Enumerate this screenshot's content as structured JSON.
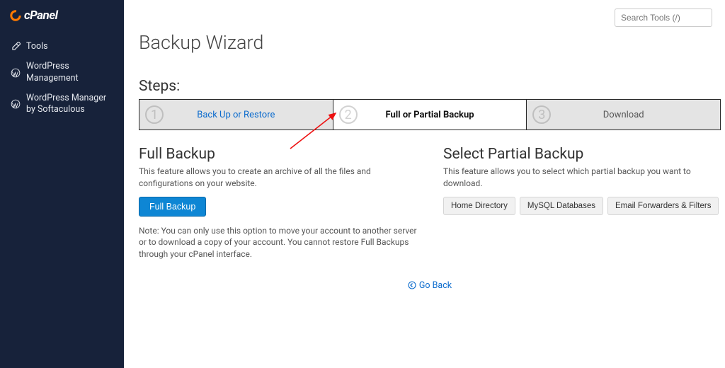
{
  "brand": {
    "name": "cPanel"
  },
  "search": {
    "placeholder": "Search Tools (/)"
  },
  "sidebar": {
    "items": [
      {
        "label": "Tools",
        "icon": "wrench-icon"
      },
      {
        "label": "WordPress Management",
        "icon": "wordpress-icon"
      },
      {
        "label": "WordPress Manager by Softaculous",
        "icon": "wordpress-icon"
      }
    ]
  },
  "page": {
    "title": "Backup Wizard",
    "steps_label": "Steps:",
    "steps": [
      {
        "num": "1",
        "label": "Back Up or Restore"
      },
      {
        "num": "2",
        "label": "Full or Partial Backup"
      },
      {
        "num": "3",
        "label": "Download"
      }
    ],
    "full_backup": {
      "title": "Full Backup",
      "desc": "This feature allows you to create an archive of all the files and configurations on your website.",
      "button": "Full Backup",
      "note": "Note: You can only use this option to move your account to another server or to download a copy of your account. You cannot restore Full Backups through your cPanel interface."
    },
    "partial_backup": {
      "title": "Select Partial Backup",
      "desc": "This feature allows you to select which partial backup you want to download.",
      "options": [
        "Home Directory",
        "MySQL Databases",
        "Email Forwarders & Filters"
      ]
    },
    "go_back": "Go Back"
  }
}
